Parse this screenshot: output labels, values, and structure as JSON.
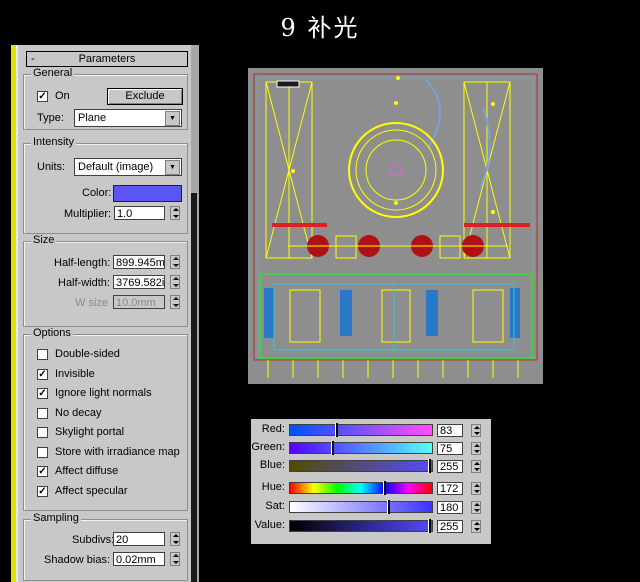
{
  "title": "9 补光",
  "panel": {
    "header": "Parameters",
    "collapse": "-",
    "general": {
      "title": "General",
      "on_label": "On",
      "on_checked": true,
      "exclude_label": "Exclude",
      "type_label": "Type:",
      "type_value": "Plane"
    },
    "intensity": {
      "title": "Intensity",
      "units_label": "Units:",
      "units_value": "Default (image)",
      "color_label": "Color:",
      "color_value": "#5a55f3",
      "multiplier_label": "Multiplier:",
      "multiplier_value": "1.0"
    },
    "size": {
      "title": "Size",
      "half_length_label": "Half-length:",
      "half_length_value": "899.945m",
      "half_width_label": "Half-width:",
      "half_width_value": "3769.582i",
      "w_size_label": "W size",
      "w_size_value": "10.0mm"
    },
    "options": {
      "title": "Options",
      "items": [
        {
          "label": "Double-sided",
          "checked": false
        },
        {
          "label": "Invisible",
          "checked": true
        },
        {
          "label": "Ignore light normals",
          "checked": true
        },
        {
          "label": "No decay",
          "checked": false
        },
        {
          "label": "Skylight portal",
          "checked": false
        },
        {
          "label": "Store with irradiance map",
          "checked": false
        },
        {
          "label": "Affect diffuse",
          "checked": true
        },
        {
          "label": "Affect specular",
          "checked": true
        }
      ]
    },
    "sampling": {
      "title": "Sampling",
      "subdivs_label": "Subdivs:",
      "subdivs_value": "20",
      "shadow_bias_label": "Shadow bias:",
      "shadow_bias_value": "0.02mm"
    }
  },
  "color_selector": {
    "rows": [
      {
        "label": "Red:",
        "value": "83"
      },
      {
        "label": "Green:",
        "value": "75"
      },
      {
        "label": "Blue:",
        "value": "255"
      },
      {
        "label": "Hue:",
        "value": "172"
      },
      {
        "label": "Sat:",
        "value": "180"
      },
      {
        "label": "Value:",
        "value": "255"
      }
    ],
    "levels": {
      "red": 0.325,
      "green": 0.294,
      "blue": 1.0,
      "hue": 0.674,
      "sat": 0.706,
      "value": 1.0
    }
  },
  "colors": {
    "light_color": "#5a55f3",
    "gizmo": "#ffff00",
    "viewport_bg": "#8e8e8e"
  }
}
